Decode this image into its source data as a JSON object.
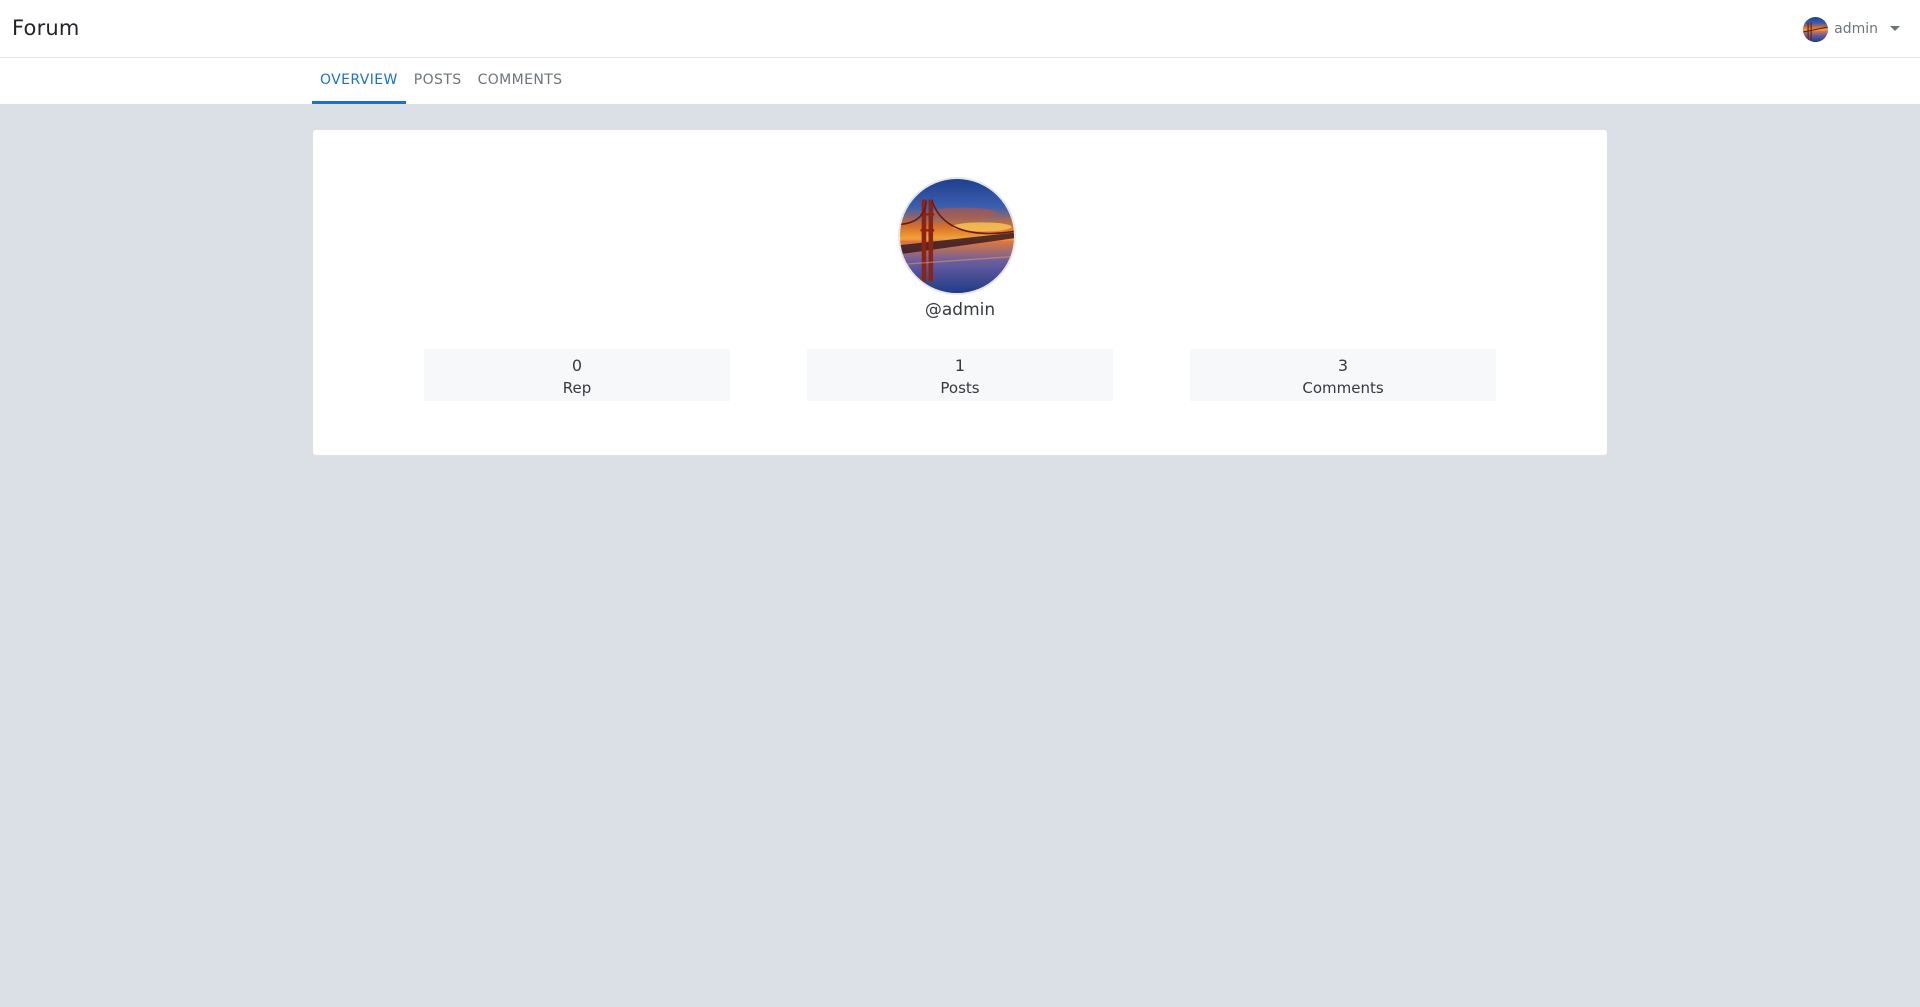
{
  "navbar": {
    "brand": "Forum",
    "user": {
      "name": "admin",
      "avatar_icon": "golden-gate-sunset-avatar"
    }
  },
  "tabs": [
    {
      "label": "OVERVIEW",
      "active": true
    },
    {
      "label": "POSTS",
      "active": false
    },
    {
      "label": "COMMENTS",
      "active": false
    }
  ],
  "profile": {
    "handle": "@admin",
    "avatar_icon": "golden-gate-sunset-avatar",
    "stats": [
      {
        "value": "0",
        "label": "Rep"
      },
      {
        "value": "1",
        "label": "Posts"
      },
      {
        "value": "3",
        "label": "Comments"
      }
    ]
  },
  "colors": {
    "accent": "#1a73c8",
    "page_background": "#dbdfe6",
    "stat_background": "#f7f8f9"
  }
}
